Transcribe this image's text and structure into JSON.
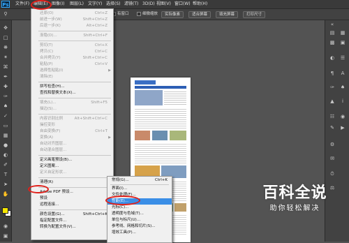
{
  "menubar": {
    "app_logo": "Ps",
    "items": [
      "文件(F)",
      "编辑(E)",
      "图像(I)",
      "图层(L)",
      "文字(Y)",
      "选择(S)",
      "滤镜(T)",
      "3D(D)",
      "视图(V)",
      "窗口(W)",
      "帮助(H)"
    ]
  },
  "options_bar": {
    "check1": "有窗口",
    "check2": "细微缩放",
    "buttons": [
      "实际像素",
      "适合屏幕",
      "填充屏幕",
      "打印尺寸"
    ]
  },
  "edit_menu": {
    "items": [
      {
        "label": "还原(O)",
        "shortcut": "Ctrl+Z",
        "disabled": true
      },
      {
        "label": "前进一步(W)",
        "shortcut": "Shift+Ctrl+Z",
        "disabled": true
      },
      {
        "label": "后退一步(K)",
        "shortcut": "Alt+Ctrl+Z",
        "disabled": true
      },
      {
        "label": "渐隐(D)...",
        "shortcut": "Shift+Ctrl+F",
        "disabled": true
      },
      {
        "label": "剪切(T)",
        "shortcut": "Ctrl+X",
        "disabled": true
      },
      {
        "label": "拷贝(C)",
        "shortcut": "Ctrl+C",
        "disabled": true
      },
      {
        "label": "合并拷贝(Y)",
        "shortcut": "Shift+Ctrl+C",
        "disabled": true
      },
      {
        "label": "粘贴(P)",
        "shortcut": "Ctrl+V",
        "disabled": true
      },
      {
        "label": "选择性粘贴(I)",
        "shortcut": "",
        "disabled": true,
        "submenu": true
      },
      {
        "label": "清除(E)",
        "shortcut": "",
        "disabled": true
      },
      {
        "label": "拼写检查(H)...",
        "shortcut": "",
        "disabled": false
      },
      {
        "label": "查找和替换文本(X)...",
        "shortcut": "",
        "disabled": false
      },
      {
        "label": "填充(L)...",
        "shortcut": "Shift+F5",
        "disabled": true
      },
      {
        "label": "描边(S)...",
        "shortcut": "",
        "disabled": true
      },
      {
        "label": "内容识别比例",
        "shortcut": "Alt+Shift+Ctrl+C",
        "disabled": true
      },
      {
        "label": "操控变形",
        "shortcut": "",
        "disabled": true
      },
      {
        "label": "自由变换(F)",
        "shortcut": "Ctrl+T",
        "disabled": true
      },
      {
        "label": "变换(A)",
        "shortcut": "",
        "disabled": true,
        "submenu": true
      },
      {
        "label": "自动对齐图层...",
        "shortcut": "",
        "disabled": true
      },
      {
        "label": "自动混合图层...",
        "shortcut": "",
        "disabled": true
      },
      {
        "label": "定义画笔预设(B)...",
        "shortcut": "",
        "disabled": false
      },
      {
        "label": "定义图案...",
        "shortcut": "",
        "disabled": false
      },
      {
        "label": "定义自定形状...",
        "shortcut": "",
        "disabled": true
      },
      {
        "label": "清理(R)",
        "shortcut": "",
        "disabled": false,
        "submenu": true
      },
      {
        "label": "Adobe PDF 预设...",
        "shortcut": "",
        "disabled": false
      },
      {
        "label": "预设",
        "shortcut": "",
        "disabled": false,
        "submenu": true
      },
      {
        "label": "远程连接...",
        "shortcut": "",
        "disabled": false
      },
      {
        "label": "颜色设置(G)...",
        "shortcut": "Shift+Ctrl+K",
        "disabled": false
      },
      {
        "label": "指定配置文件...",
        "shortcut": "",
        "disabled": false
      },
      {
        "label": "转换为配置文件(V)...",
        "shortcut": "",
        "disabled": false
      }
    ]
  },
  "submenu": {
    "items": [
      {
        "label": "常规(G)...",
        "shortcut": "Ctrl+K",
        "highlighted": false
      },
      {
        "label": "界面(I)...",
        "shortcut": "",
        "highlighted": false
      },
      {
        "label": "文件处理(F)...",
        "shortcut": "",
        "highlighted": false
      },
      {
        "label": "性能(E)...",
        "shortcut": "",
        "highlighted": true
      },
      {
        "label": "光标(C)...",
        "shortcut": "",
        "highlighted": false
      },
      {
        "label": "透明度与色域(T)...",
        "shortcut": "",
        "highlighted": false
      },
      {
        "label": "单位与标尺(U)...",
        "shortcut": "",
        "highlighted": false
      },
      {
        "label": "参考线、网格和切片(S)...",
        "shortcut": "",
        "highlighted": false
      },
      {
        "label": "增效工具(P)...",
        "shortcut": "",
        "highlighted": false
      }
    ]
  },
  "watermark": {
    "title": "百科全说",
    "subtitle": "助你轻松解决"
  },
  "colors": {
    "foreground": "#f5e600",
    "background": "#ffffff",
    "highlight": "#3a8ee6",
    "annotation": "#e0201a"
  }
}
